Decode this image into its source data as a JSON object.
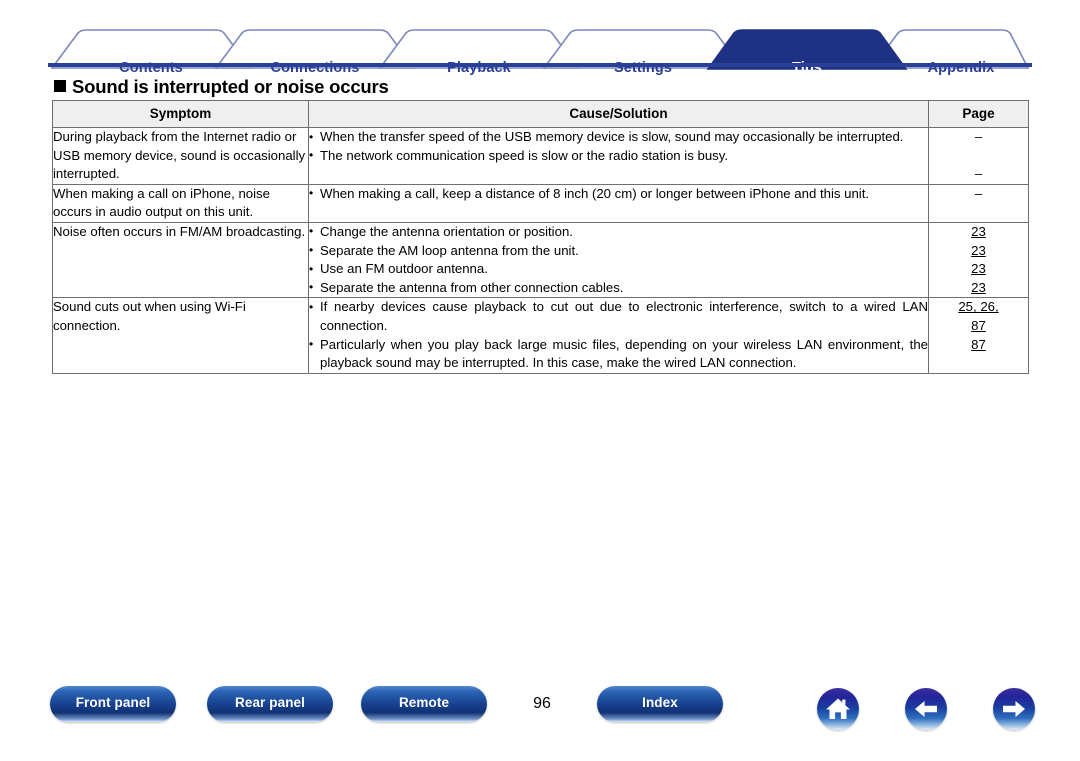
{
  "tabs": [
    {
      "label": "Contents",
      "active": false
    },
    {
      "label": "Connections",
      "active": false
    },
    {
      "label": "Playback",
      "active": false
    },
    {
      "label": "Settings",
      "active": false
    },
    {
      "label": "Tips",
      "active": true
    },
    {
      "label": "Appendix",
      "active": false
    }
  ],
  "heading": "Sound is interrupted or noise occurs",
  "table": {
    "headers": {
      "symptom": "Symptom",
      "cause": "Cause/Solution",
      "page": "Page"
    },
    "rows": [
      {
        "symptom": "During playback from the Internet radio or USB memory device, sound is occasionally interrupted.",
        "causes": [
          "When the transfer speed of the USB memory device is slow, sound may occasionally be interrupted.",
          "The network communication speed is slow or the radio station is busy."
        ],
        "pages": [
          "–",
          "",
          "–"
        ]
      },
      {
        "symptom": "When making a call on iPhone, noise occurs in audio output on this unit.",
        "causes": [
          "When making a call, keep a distance of 8 inch (20 cm) or longer between iPhone and this unit."
        ],
        "pages": [
          "–"
        ]
      },
      {
        "symptom": "Noise often occurs in FM/AM broadcasting.",
        "causes": [
          "Change the antenna orientation or position.",
          "Separate the AM loop antenna from the unit.",
          "Use an FM outdoor antenna.",
          "Separate the antenna from other connection cables."
        ],
        "pages": [
          "23",
          "23",
          "23",
          "23"
        ]
      },
      {
        "symptom": "Sound cuts out when using Wi-Fi connection.",
        "causes": [
          "If nearby devices cause playback to cut out due to electronic interference, switch to a wired LAN connection.",
          "Particularly when you play back large music files, depending on your wireless LAN environment, the playback sound may be interrupted. In this case, make the wired LAN connection."
        ],
        "pages": [
          "25, 26,",
          "87",
          "87"
        ]
      }
    ]
  },
  "footer": {
    "buttons": [
      {
        "label": "Front panel"
      },
      {
        "label": "Rear panel"
      },
      {
        "label": "Remote"
      },
      {
        "label": "Index"
      }
    ],
    "page_number": "96",
    "icons": [
      {
        "name": "home-icon"
      },
      {
        "name": "arrow-left-icon"
      },
      {
        "name": "arrow-right-icon"
      }
    ]
  },
  "colors": {
    "tab_blue": "#2a3f97",
    "tab_text": "#2a3f97",
    "active_tab_bg": "#1f3184",
    "header_row_bg": "#efefef",
    "border": "#6f6f6f"
  }
}
